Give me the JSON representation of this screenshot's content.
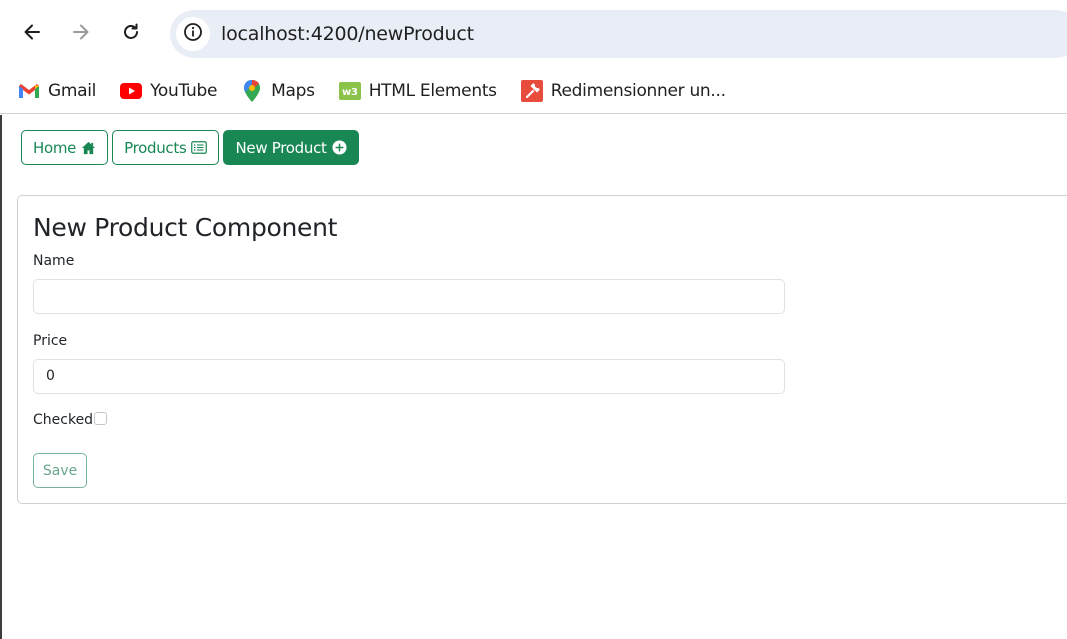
{
  "browser": {
    "url_host": "localhost",
    "url_path": ":4200/newProduct",
    "bookmarks": [
      {
        "label": "Gmail",
        "icon": "gmail-icon"
      },
      {
        "label": "YouTube",
        "icon": "youtube-icon"
      },
      {
        "label": "Maps",
        "icon": "maps-icon"
      },
      {
        "label": "HTML Elements",
        "icon": "w3-icon"
      },
      {
        "label": "Redimensionner un...",
        "icon": "wrench-icon"
      }
    ]
  },
  "nav": {
    "home_label": "Home",
    "products_label": "Products",
    "new_product_label": "New Product"
  },
  "form": {
    "title": "New Product Component",
    "name_label": "Name",
    "name_value": "",
    "price_label": "Price",
    "price_value": "0",
    "checked_label": "Checked",
    "checked_value": false,
    "save_label": "Save"
  },
  "colors": {
    "accent": "#198754",
    "omnibox_bg": "#e9eef6"
  }
}
